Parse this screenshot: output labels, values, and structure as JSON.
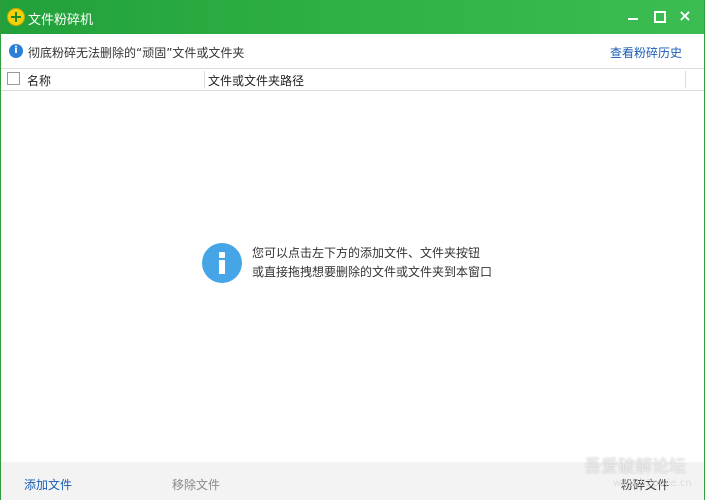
{
  "window": {
    "title": "文件粉碎机",
    "minimize_label": "",
    "maximize_label": "",
    "close_label": "×"
  },
  "infobar": {
    "icon": "info-icon",
    "text": "彻底粉碎无法删除的“顽固”文件或文件夹",
    "history_link": "查看粉碎历史"
  },
  "table": {
    "columns": [
      "名称",
      "文件或文件夹路径"
    ],
    "rows": []
  },
  "empty_state": {
    "icon": "info-icon",
    "line1": "您可以点击左下方的添加文件、文件夹按钮",
    "line2": "或直接拖拽想要删除的文件或文件夹到本窗口"
  },
  "footer": {
    "add_file": "添加文件",
    "remove_file": "移除文件",
    "shred_file": "粉碎文件"
  },
  "watermark": {
    "line1": "吾爱破解论坛",
    "line2": "www.52pojie.cn"
  },
  "colors": {
    "titlebar": "#2fb146",
    "link": "#1a5db3",
    "info_icon": "#45a5e6"
  }
}
